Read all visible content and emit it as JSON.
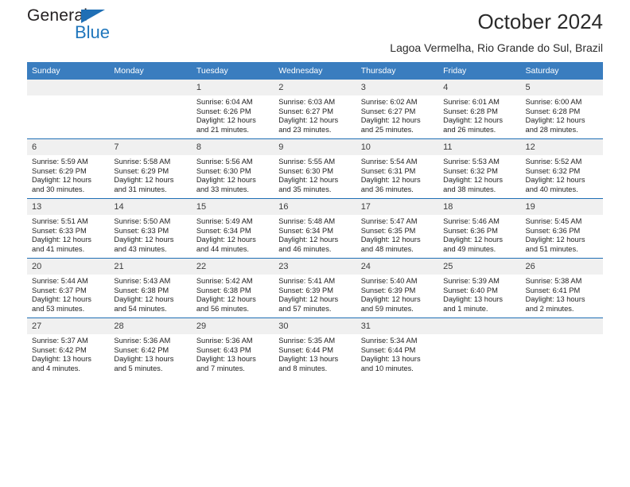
{
  "logo": {
    "word_general": "General",
    "word_blue": "Blue",
    "flag_color": "#1f6fb5",
    "blue_color": "#1f76bc"
  },
  "header": {
    "title": "October 2024",
    "subtitle": "Lagoa Vermelha, Rio Grande do Sul, Brazil"
  },
  "theme": {
    "header_bg": "#3a7dbf",
    "row_divider": "#1f6fb5",
    "daynum_bg": "#f0f0f0"
  },
  "weekday_headers": [
    "Sunday",
    "Monday",
    "Tuesday",
    "Wednesday",
    "Thursday",
    "Friday",
    "Saturday"
  ],
  "weeks": [
    [
      {
        "day": "",
        "sunrise": "",
        "sunset": "",
        "daylight1": "",
        "daylight2": "",
        "empty": true
      },
      {
        "day": "",
        "sunrise": "",
        "sunset": "",
        "daylight1": "",
        "daylight2": "",
        "empty": true
      },
      {
        "day": "1",
        "sunrise": "Sunrise: 6:04 AM",
        "sunset": "Sunset: 6:26 PM",
        "daylight1": "Daylight: 12 hours",
        "daylight2": "and 21 minutes."
      },
      {
        "day": "2",
        "sunrise": "Sunrise: 6:03 AM",
        "sunset": "Sunset: 6:27 PM",
        "daylight1": "Daylight: 12 hours",
        "daylight2": "and 23 minutes."
      },
      {
        "day": "3",
        "sunrise": "Sunrise: 6:02 AM",
        "sunset": "Sunset: 6:27 PM",
        "daylight1": "Daylight: 12 hours",
        "daylight2": "and 25 minutes."
      },
      {
        "day": "4",
        "sunrise": "Sunrise: 6:01 AM",
        "sunset": "Sunset: 6:28 PM",
        "daylight1": "Daylight: 12 hours",
        "daylight2": "and 26 minutes."
      },
      {
        "day": "5",
        "sunrise": "Sunrise: 6:00 AM",
        "sunset": "Sunset: 6:28 PM",
        "daylight1": "Daylight: 12 hours",
        "daylight2": "and 28 minutes."
      }
    ],
    [
      {
        "day": "6",
        "sunrise": "Sunrise: 5:59 AM",
        "sunset": "Sunset: 6:29 PM",
        "daylight1": "Daylight: 12 hours",
        "daylight2": "and 30 minutes."
      },
      {
        "day": "7",
        "sunrise": "Sunrise: 5:58 AM",
        "sunset": "Sunset: 6:29 PM",
        "daylight1": "Daylight: 12 hours",
        "daylight2": "and 31 minutes."
      },
      {
        "day": "8",
        "sunrise": "Sunrise: 5:56 AM",
        "sunset": "Sunset: 6:30 PM",
        "daylight1": "Daylight: 12 hours",
        "daylight2": "and 33 minutes."
      },
      {
        "day": "9",
        "sunrise": "Sunrise: 5:55 AM",
        "sunset": "Sunset: 6:30 PM",
        "daylight1": "Daylight: 12 hours",
        "daylight2": "and 35 minutes."
      },
      {
        "day": "10",
        "sunrise": "Sunrise: 5:54 AM",
        "sunset": "Sunset: 6:31 PM",
        "daylight1": "Daylight: 12 hours",
        "daylight2": "and 36 minutes."
      },
      {
        "day": "11",
        "sunrise": "Sunrise: 5:53 AM",
        "sunset": "Sunset: 6:32 PM",
        "daylight1": "Daylight: 12 hours",
        "daylight2": "and 38 minutes."
      },
      {
        "day": "12",
        "sunrise": "Sunrise: 5:52 AM",
        "sunset": "Sunset: 6:32 PM",
        "daylight1": "Daylight: 12 hours",
        "daylight2": "and 40 minutes."
      }
    ],
    [
      {
        "day": "13",
        "sunrise": "Sunrise: 5:51 AM",
        "sunset": "Sunset: 6:33 PM",
        "daylight1": "Daylight: 12 hours",
        "daylight2": "and 41 minutes."
      },
      {
        "day": "14",
        "sunrise": "Sunrise: 5:50 AM",
        "sunset": "Sunset: 6:33 PM",
        "daylight1": "Daylight: 12 hours",
        "daylight2": "and 43 minutes."
      },
      {
        "day": "15",
        "sunrise": "Sunrise: 5:49 AM",
        "sunset": "Sunset: 6:34 PM",
        "daylight1": "Daylight: 12 hours",
        "daylight2": "and 44 minutes."
      },
      {
        "day": "16",
        "sunrise": "Sunrise: 5:48 AM",
        "sunset": "Sunset: 6:34 PM",
        "daylight1": "Daylight: 12 hours",
        "daylight2": "and 46 minutes."
      },
      {
        "day": "17",
        "sunrise": "Sunrise: 5:47 AM",
        "sunset": "Sunset: 6:35 PM",
        "daylight1": "Daylight: 12 hours",
        "daylight2": "and 48 minutes."
      },
      {
        "day": "18",
        "sunrise": "Sunrise: 5:46 AM",
        "sunset": "Sunset: 6:36 PM",
        "daylight1": "Daylight: 12 hours",
        "daylight2": "and 49 minutes."
      },
      {
        "day": "19",
        "sunrise": "Sunrise: 5:45 AM",
        "sunset": "Sunset: 6:36 PM",
        "daylight1": "Daylight: 12 hours",
        "daylight2": "and 51 minutes."
      }
    ],
    [
      {
        "day": "20",
        "sunrise": "Sunrise: 5:44 AM",
        "sunset": "Sunset: 6:37 PM",
        "daylight1": "Daylight: 12 hours",
        "daylight2": "and 53 minutes."
      },
      {
        "day": "21",
        "sunrise": "Sunrise: 5:43 AM",
        "sunset": "Sunset: 6:38 PM",
        "daylight1": "Daylight: 12 hours",
        "daylight2": "and 54 minutes."
      },
      {
        "day": "22",
        "sunrise": "Sunrise: 5:42 AM",
        "sunset": "Sunset: 6:38 PM",
        "daylight1": "Daylight: 12 hours",
        "daylight2": "and 56 minutes."
      },
      {
        "day": "23",
        "sunrise": "Sunrise: 5:41 AM",
        "sunset": "Sunset: 6:39 PM",
        "daylight1": "Daylight: 12 hours",
        "daylight2": "and 57 minutes."
      },
      {
        "day": "24",
        "sunrise": "Sunrise: 5:40 AM",
        "sunset": "Sunset: 6:39 PM",
        "daylight1": "Daylight: 12 hours",
        "daylight2": "and 59 minutes."
      },
      {
        "day": "25",
        "sunrise": "Sunrise: 5:39 AM",
        "sunset": "Sunset: 6:40 PM",
        "daylight1": "Daylight: 13 hours",
        "daylight2": "and 1 minute."
      },
      {
        "day": "26",
        "sunrise": "Sunrise: 5:38 AM",
        "sunset": "Sunset: 6:41 PM",
        "daylight1": "Daylight: 13 hours",
        "daylight2": "and 2 minutes."
      }
    ],
    [
      {
        "day": "27",
        "sunrise": "Sunrise: 5:37 AM",
        "sunset": "Sunset: 6:42 PM",
        "daylight1": "Daylight: 13 hours",
        "daylight2": "and 4 minutes."
      },
      {
        "day": "28",
        "sunrise": "Sunrise: 5:36 AM",
        "sunset": "Sunset: 6:42 PM",
        "daylight1": "Daylight: 13 hours",
        "daylight2": "and 5 minutes."
      },
      {
        "day": "29",
        "sunrise": "Sunrise: 5:36 AM",
        "sunset": "Sunset: 6:43 PM",
        "daylight1": "Daylight: 13 hours",
        "daylight2": "and 7 minutes."
      },
      {
        "day": "30",
        "sunrise": "Sunrise: 5:35 AM",
        "sunset": "Sunset: 6:44 PM",
        "daylight1": "Daylight: 13 hours",
        "daylight2": "and 8 minutes."
      },
      {
        "day": "31",
        "sunrise": "Sunrise: 5:34 AM",
        "sunset": "Sunset: 6:44 PM",
        "daylight1": "Daylight: 13 hours",
        "daylight2": "and 10 minutes."
      },
      {
        "day": "",
        "sunrise": "",
        "sunset": "",
        "daylight1": "",
        "daylight2": "",
        "empty": true
      },
      {
        "day": "",
        "sunrise": "",
        "sunset": "",
        "daylight1": "",
        "daylight2": "",
        "empty": true
      }
    ]
  ]
}
